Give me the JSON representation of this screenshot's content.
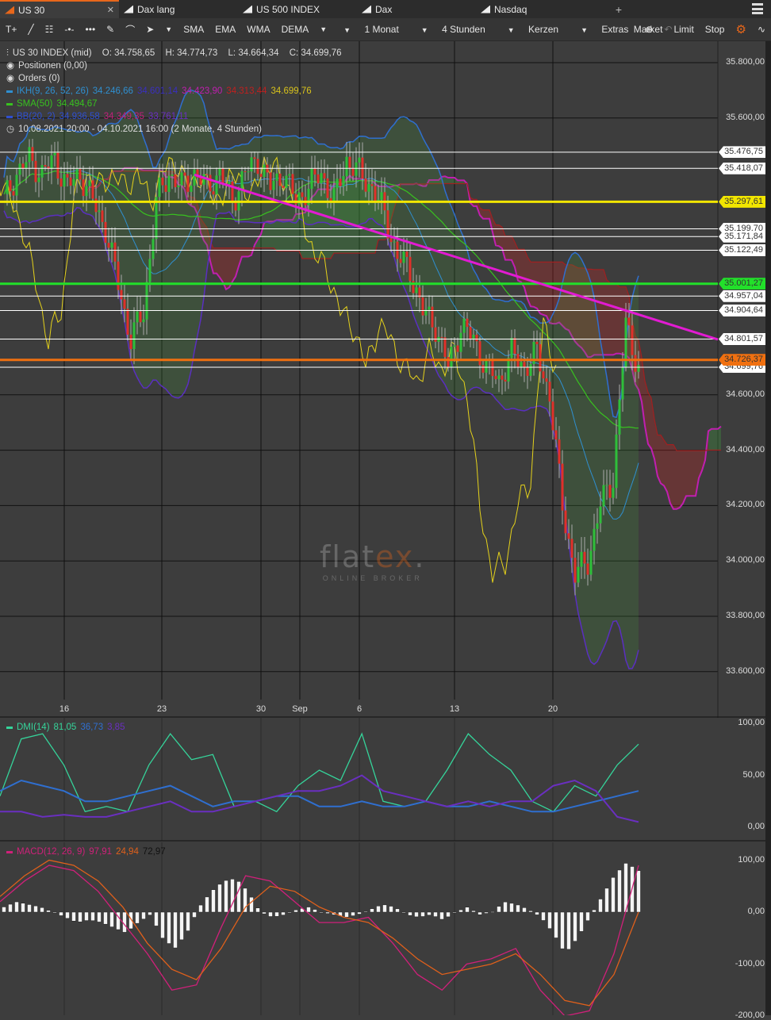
{
  "tabs": [
    {
      "label": "US 30",
      "active": true
    },
    {
      "label": "Dax lang"
    },
    {
      "label": "US 500 INDEX"
    },
    {
      "label": "Dax"
    },
    {
      "label": "Nasdaq"
    }
  ],
  "tab_add": "+",
  "toolbar": {
    "indicators": [
      "SMA",
      "EMA",
      "WMA",
      "DEMA"
    ],
    "period": "1 Monat",
    "interval": "4 Stunden",
    "chart_type": "Kerzen",
    "extras": "Extras",
    "orders": [
      "Market",
      "Limit",
      "Stop"
    ]
  },
  "legend": {
    "instrument": "US 30 INDEX (mid)",
    "open": "O: 34.758,65",
    "high": "H: 34.774,73",
    "low": "L: 34.664,34",
    "close": "C: 34.699,76",
    "positions": "Positionen (0,00)",
    "orders": "Orders (0)",
    "ikh": {
      "label": "IKH(9, 26, 52, 26)",
      "v1": "34.246,66",
      "v2": "34.601,14",
      "v3": "34.423,90",
      "v4": "34.313,44",
      "v5": "34.699,76"
    },
    "sma": {
      "label": "SMA(50)",
      "v": "34.494,67"
    },
    "bb": {
      "label": "BB(20, 2)",
      "v1": "34.936,58",
      "v2": "34.349,35",
      "v3": "33.761,11"
    },
    "range": "10.08.2021 20:00 - 04.10.2021 16:00   (2 Monate, 4 Stunden)"
  },
  "colors": {
    "accent": "#e8671b",
    "up": "#2fbf3a",
    "down": "#e0302a",
    "sma": "#38c21f",
    "bb": "#2f4fd0",
    "chikou": "#e5d21b",
    "trend": "#e21bd2",
    "dmi_plus": "#35d49a",
    "dmi_minus": "#2f6fd0",
    "adx": "#6a2fc0",
    "macd": "#d0207a",
    "signal": "#e0601b"
  },
  "chart_data": [
    {
      "type": "candlestick",
      "title": "US 30 INDEX (mid)",
      "ylim": [
        33500,
        35900
      ],
      "y_ticks": [
        "35.800,00",
        "35.600,00",
        "34.600,00",
        "34.400,00",
        "34.200,00",
        "34.000,00",
        "33.800,00",
        "33.600,00"
      ],
      "y_tick_values": [
        35800,
        35600,
        34600,
        34400,
        34200,
        34000,
        33800,
        33600
      ],
      "x_ticks": [
        "16",
        "23",
        "30",
        "Sep",
        "6",
        "13",
        "20"
      ],
      "close_anchors": [
        35300,
        35400,
        35450,
        35400,
        35450,
        35350,
        35400,
        35300,
        35200,
        35000,
        34800,
        34900,
        35300,
        35400,
        35350,
        35400,
        35350,
        35400,
        35300,
        35400,
        35450,
        35350,
        35400,
        35300,
        35350,
        35400,
        35300,
        35450,
        35400,
        35350,
        35250,
        35100,
        35050,
        34900,
        34850,
        34700,
        34850,
        34800,
        34700,
        34650,
        34750,
        34700,
        34750,
        34600,
        34200,
        33950,
        34000,
        34200,
        34300,
        34850,
        34700
      ],
      "levels": [
        {
          "label": "35.476,75",
          "value": 35476.75,
          "color": "#ffffff",
          "text": "#333"
        },
        {
          "label": "35.418,07",
          "value": 35418.07,
          "color": "#ffffff",
          "text": "#333"
        },
        {
          "label": "35.297,61",
          "value": 35297.61,
          "color": "#f2e600",
          "text": "#333"
        },
        {
          "label": "35.199,70",
          "value": 35199.7,
          "color": "#ffffff",
          "text": "#333"
        },
        {
          "label": "35.171,84",
          "value": 35171.84,
          "color": "#ffffff",
          "text": "#333"
        },
        {
          "label": "35.122,49",
          "value": 35122.49,
          "color": "#ffffff",
          "text": "#333"
        },
        {
          "label": "35.001,27",
          "value": 35001.27,
          "color": "#22e02a",
          "text": "#333"
        },
        {
          "label": "34.957,04",
          "value": 34957.04,
          "color": "#ffffff",
          "text": "#333"
        },
        {
          "label": "34.904,64",
          "value": 34904.64,
          "color": "#ffffff",
          "text": "#333"
        },
        {
          "label": "34.801,57",
          "value": 34801.57,
          "color": "#ffffff",
          "text": "#333"
        },
        {
          "label": "34.699,76",
          "value": 34699.76,
          "color": "#ffffff",
          "text": "#333"
        },
        {
          "label": "34.726,37",
          "value": 34726.37,
          "color": "#f07010",
          "text": "#333"
        }
      ],
      "trendline": {
        "from_bar": 60,
        "from_price": 35395,
        "to_bar": 225,
        "to_price": 34800
      }
    },
    {
      "type": "line",
      "title": "DMI(14)",
      "values_label": [
        "81,05",
        "36,73",
        "3,85"
      ],
      "y_ticks": [
        "100,00",
        "50,00",
        "0,00"
      ],
      "ylim": [
        0,
        100
      ],
      "series": [
        {
          "name": "+DI",
          "values": [
            30,
            85,
            90,
            60,
            15,
            20,
            15,
            60,
            90,
            65,
            70,
            20,
            25,
            15,
            40,
            55,
            45,
            90,
            25,
            20,
            25,
            55,
            90,
            70,
            55,
            25,
            15,
            40,
            30,
            60,
            80
          ]
        },
        {
          "name": "-DI",
          "values": [
            35,
            45,
            40,
            35,
            25,
            25,
            30,
            35,
            40,
            30,
            20,
            25,
            25,
            30,
            30,
            20,
            20,
            25,
            20,
            20,
            25,
            20,
            20,
            25,
            20,
            15,
            15,
            20,
            25,
            30,
            35
          ]
        },
        {
          "name": "ADX",
          "values": [
            15,
            15,
            10,
            12,
            10,
            10,
            15,
            20,
            25,
            15,
            15,
            20,
            25,
            30,
            35,
            35,
            40,
            50,
            35,
            30,
            25,
            20,
            25,
            20,
            25,
            25,
            40,
            45,
            35,
            10,
            5
          ]
        }
      ]
    },
    {
      "type": "bar+line",
      "title": "MACD(12, 26, 9)",
      "values_label": [
        "97,91",
        "24,94",
        "72,97"
      ],
      "y_ticks": [
        "100,00",
        "0,00",
        "-100,00",
        "-200,00"
      ],
      "ylim": [
        -200,
        120
      ],
      "histogram": [
        10,
        20,
        15,
        10,
        0,
        -10,
        -20,
        -15,
        -20,
        -30,
        -40,
        -20,
        -5,
        -50,
        -70,
        -40,
        10,
        40,
        60,
        65,
        40,
        0,
        -10,
        -5,
        5,
        10,
        0,
        -5,
        -10,
        -5,
        5,
        15,
        10,
        -5,
        -10,
        -5,
        -15,
        0,
        10,
        -5,
        0,
        20,
        15,
        5,
        -10,
        -40,
        -80,
        -50,
        -10,
        30,
        70,
        95,
        80
      ],
      "series": [
        {
          "name": "MACD",
          "values": [
            20,
            60,
            90,
            80,
            40,
            -20,
            -80,
            -150,
            -140,
            -30,
            70,
            60,
            20,
            -20,
            -20,
            -10,
            -60,
            -120,
            -150,
            -100,
            -90,
            -70,
            -150,
            -200,
            -190,
            -80,
            90
          ]
        },
        {
          "name": "Signal",
          "values": [
            30,
            70,
            100,
            90,
            60,
            10,
            -60,
            -110,
            -130,
            -70,
            10,
            50,
            40,
            10,
            -10,
            -20,
            -50,
            -90,
            -120,
            -110,
            -100,
            -80,
            -120,
            -170,
            -180,
            -120,
            0
          ]
        }
      ]
    }
  ],
  "watermark": {
    "brand": "flatex",
    "tagline": "ONLINE BROKER"
  }
}
